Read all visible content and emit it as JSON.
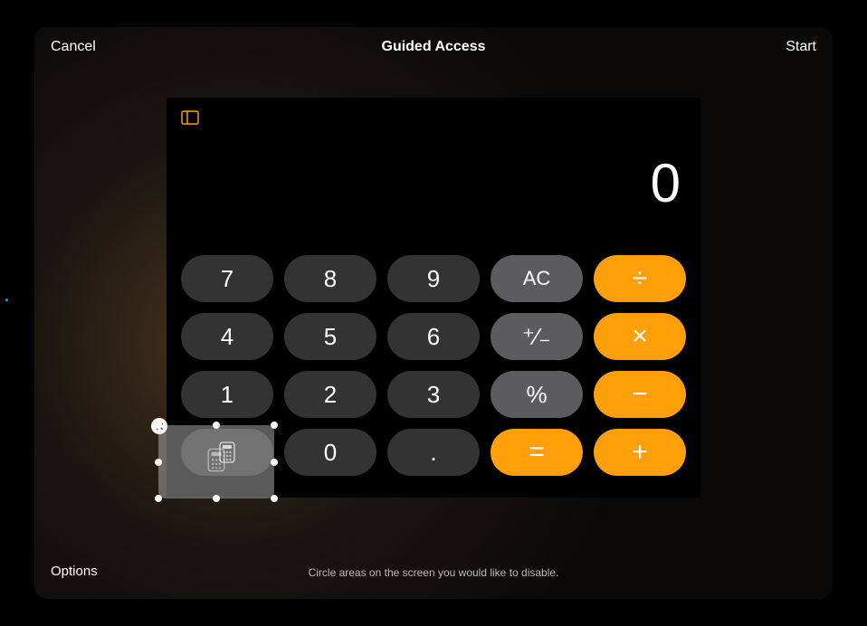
{
  "nav": {
    "cancel": "Cancel",
    "title": "Guided Access",
    "start": "Start"
  },
  "calculator": {
    "display": "0",
    "keys": {
      "r0": [
        "7",
        "8",
        "9",
        "AC",
        "÷"
      ],
      "r1": [
        "4",
        "5",
        "6",
        "⁺∕₋",
        "×"
      ],
      "r2": [
        "1",
        "2",
        "3",
        "%",
        "−"
      ],
      "r3": [
        "",
        "0",
        ".",
        "=",
        "+"
      ]
    }
  },
  "footer": {
    "options": "Options",
    "hint": "Circle areas on the screen you would like to disable."
  },
  "icons": {
    "sidebar": "sidebar-icon",
    "calculator": "calculator-icon",
    "close": "close-icon"
  },
  "colors": {
    "orange": "#ff9f0a",
    "gray": "#5c5c5e",
    "dark": "#333333",
    "background": "#000000"
  }
}
